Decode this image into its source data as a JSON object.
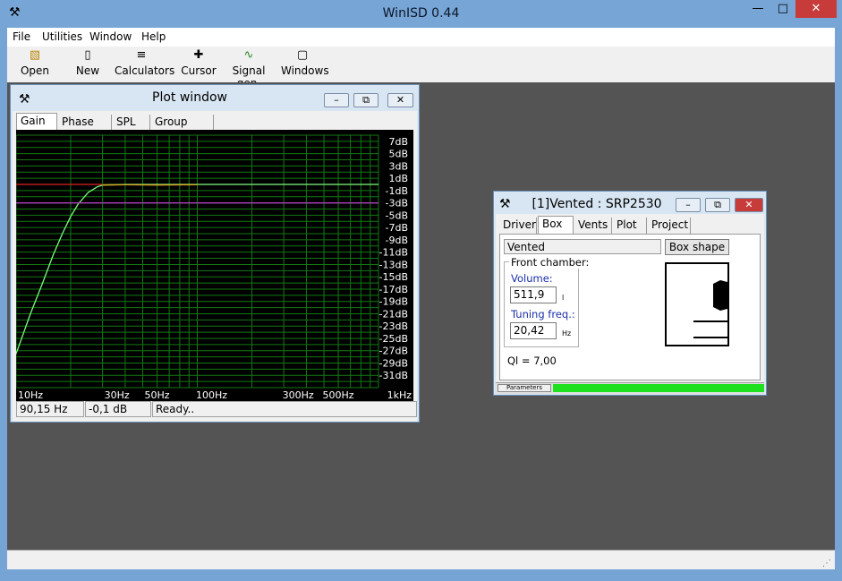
{
  "app": {
    "title": "WinISD 0.44"
  },
  "menu": {
    "items": [
      "File",
      "Utilities",
      "Window",
      "Help"
    ]
  },
  "toolbar": {
    "items": [
      {
        "label": "Open",
        "icon": "folder-open-icon"
      },
      {
        "label": "New",
        "icon": "new-document-icon"
      },
      {
        "label": "Calculators",
        "icon": "calculator-icon"
      },
      {
        "label": "Cursor",
        "icon": "crosshair-icon"
      },
      {
        "label": "Signal gen.",
        "icon": "sine-wave-icon"
      },
      {
        "label": "Windows",
        "icon": "window-icon"
      }
    ]
  },
  "plot_window": {
    "title": "Plot window",
    "tabs": [
      "Gain",
      "Phase plot",
      "SPL",
      "Group delay"
    ],
    "selected_tab": "Gain",
    "status": {
      "freq": "90,15 Hz",
      "gain": "-0,1 dB",
      "state": "Ready.."
    }
  },
  "chart_data": {
    "type": "line",
    "xscale": "log",
    "xlim": [
      10,
      1000
    ],
    "ylim": [
      -33,
      8
    ],
    "y_tick_labels": [
      "7dB",
      "5dB",
      "3dB",
      "1dB",
      "-1dB",
      "-3dB",
      "-5dB",
      "-7dB",
      "-9dB",
      "-11dB",
      "-13dB",
      "-15dB",
      "-17dB",
      "-19dB",
      "-21dB",
      "-23dB",
      "-25dB",
      "-27dB",
      "-29dB",
      "-31dB"
    ],
    "x_tick_labels": [
      {
        "label": "10Hz",
        "value": 10
      },
      {
        "label": "30Hz",
        "value": 30
      },
      {
        "label": "50Hz",
        "value": 50
      },
      {
        "label": "100Hz",
        "value": 100
      },
      {
        "label": "300Hz",
        "value": 300
      },
      {
        "label": "500Hz",
        "value": 500
      },
      {
        "label": "1kHz",
        "value": 1000
      }
    ],
    "grid": true,
    "series": [
      {
        "color": "#7cfc7c",
        "x": [
          10,
          12,
          14,
          16,
          18,
          20,
          22,
          25,
          28,
          30,
          40,
          60,
          100,
          200,
          500,
          1000
        ],
        "y": [
          -27.5,
          -21,
          -16,
          -11.5,
          -8,
          -5.2,
          -3.2,
          -1.3,
          -0.4,
          -0.1,
          0,
          0,
          0,
          0,
          0,
          0
        ]
      },
      {
        "color": "#d8a020",
        "x": [
          30,
          40,
          60,
          100
        ],
        "y": [
          -0.1,
          -0.05,
          -0.1,
          -0.05
        ]
      },
      {
        "color": "#e02020",
        "x": [
          10,
          30
        ],
        "y": [
          0,
          0
        ]
      },
      {
        "color": "#b040c0",
        "x": [
          10,
          1000
        ],
        "y": [
          -3,
          -3
        ]
      }
    ]
  },
  "project_window": {
    "title": "[1]Vented : SRP2530",
    "tabs": [
      "Driver",
      "Box",
      "Vents",
      "Plot",
      "Project"
    ],
    "selected_tab": "Box",
    "box_type": "Vented",
    "box_shape_button": "Box shape",
    "front_chamber_label": "Front chamber:",
    "volume_label": "Volume:",
    "volume_value": "511,9",
    "volume_unit": "l",
    "tuning_label": "Tuning freq.:",
    "tuning_value": "20,42",
    "tuning_unit": "Hz",
    "ql": "Ql = 7,00",
    "progress_label": "Parameters",
    "progress_color": "#1ee01e",
    "progress_value": 1.0
  },
  "colors": {
    "mdi_background": "#545454",
    "frame": "#76a5d5",
    "close_button": "#c73b3b"
  }
}
